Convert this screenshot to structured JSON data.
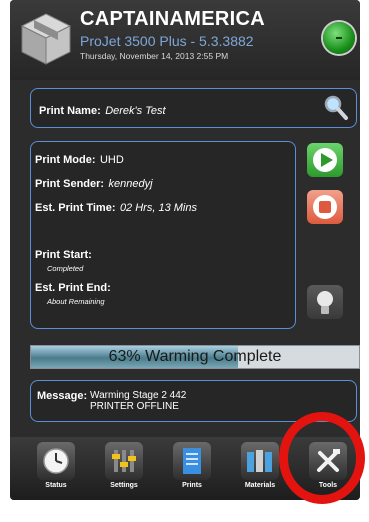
{
  "header": {
    "printer_name": "CAPTAINAMERICA",
    "model": "ProJet 3500 Plus - 5.3.3882",
    "datetime": "Thursday, November 14, 2013 2:55 PM",
    "status_color": "#2fa32f"
  },
  "print_name": {
    "label": "Print Name:",
    "value": "Derek's Test"
  },
  "details": {
    "mode_label": "Print Mode:",
    "mode_value": "UHD",
    "sender_label": "Print Sender:",
    "sender_value": "kennedyj",
    "time_label": "Est. Print Time:",
    "time_value": "02 Hrs, 13 Mins",
    "start_label": "Print Start:",
    "start_value": "Completed",
    "end_label": "Est. Print End:",
    "end_value": "About  Remaining"
  },
  "progress": {
    "text": "63% Warming Complete",
    "percent": 63
  },
  "message": {
    "label": "Message:",
    "line1": "Warming Stage 2 442",
    "line2": "PRINTER OFFLINE"
  },
  "toolbar": {
    "items": [
      {
        "label": "Status",
        "icon": "clock-icon"
      },
      {
        "label": "Settings",
        "icon": "sliders-icon"
      },
      {
        "label": "Prints",
        "icon": "document-icon"
      },
      {
        "label": "Materials",
        "icon": "cartridges-icon"
      },
      {
        "label": "Tools",
        "icon": "tools-icon"
      }
    ]
  },
  "colors": {
    "accent": "#5b8fd6",
    "highlight_ring": "#e3140f"
  }
}
